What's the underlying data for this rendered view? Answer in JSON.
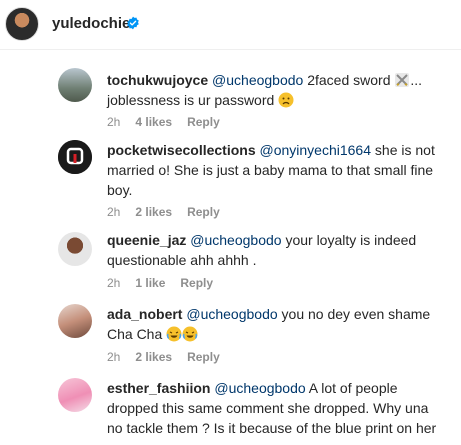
{
  "header": {
    "username": "yuledochie",
    "verified_icon": "verified-badge-icon",
    "accent_color": "#0095f6"
  },
  "comments": [
    {
      "username": "tochukwujoyce",
      "mention": "@ucheogbodo",
      "text_line1": " 2faced sword ",
      "text_line2": "joblessness is ur password ",
      "emoji1": "crossed-swords-icon",
      "emoji2": "sad-face-icon",
      "time": "2h",
      "likes": "4 likes",
      "reply": "Reply"
    },
    {
      "username": "pocketwisecollections",
      "mention": "@onyinyechi1664",
      "text_line1": " she is not",
      "text_line2": "married o! She is just a baby mama to that small fine",
      "text_line3": "boy.",
      "time": "2h",
      "likes": "2 likes",
      "reply": "Reply"
    },
    {
      "username": "queenie_jaz",
      "mention": "@ucheogbodo",
      "text_line1": " your loyalty is indeed",
      "text_line2": "questionable ahh ahhh .",
      "time": "2h",
      "likes": "1 like",
      "reply": "Reply"
    },
    {
      "username": "ada_nobert",
      "mention": "@ucheogbodo",
      "text_line1": " you no dey even shame",
      "text_line2": "Cha Cha",
      "emoji": "crying-laughing-icon",
      "time": "2h",
      "likes": "2 likes",
      "reply": "Reply"
    },
    {
      "username": "esther_fashiion",
      "mention": "@ucheogbodo",
      "text_line1": " A lot of people",
      "text_line2": "dropped this same comment she dropped. Why una",
      "text_line3": "no tackle them ? Is it because of the blue print on her"
    }
  ]
}
